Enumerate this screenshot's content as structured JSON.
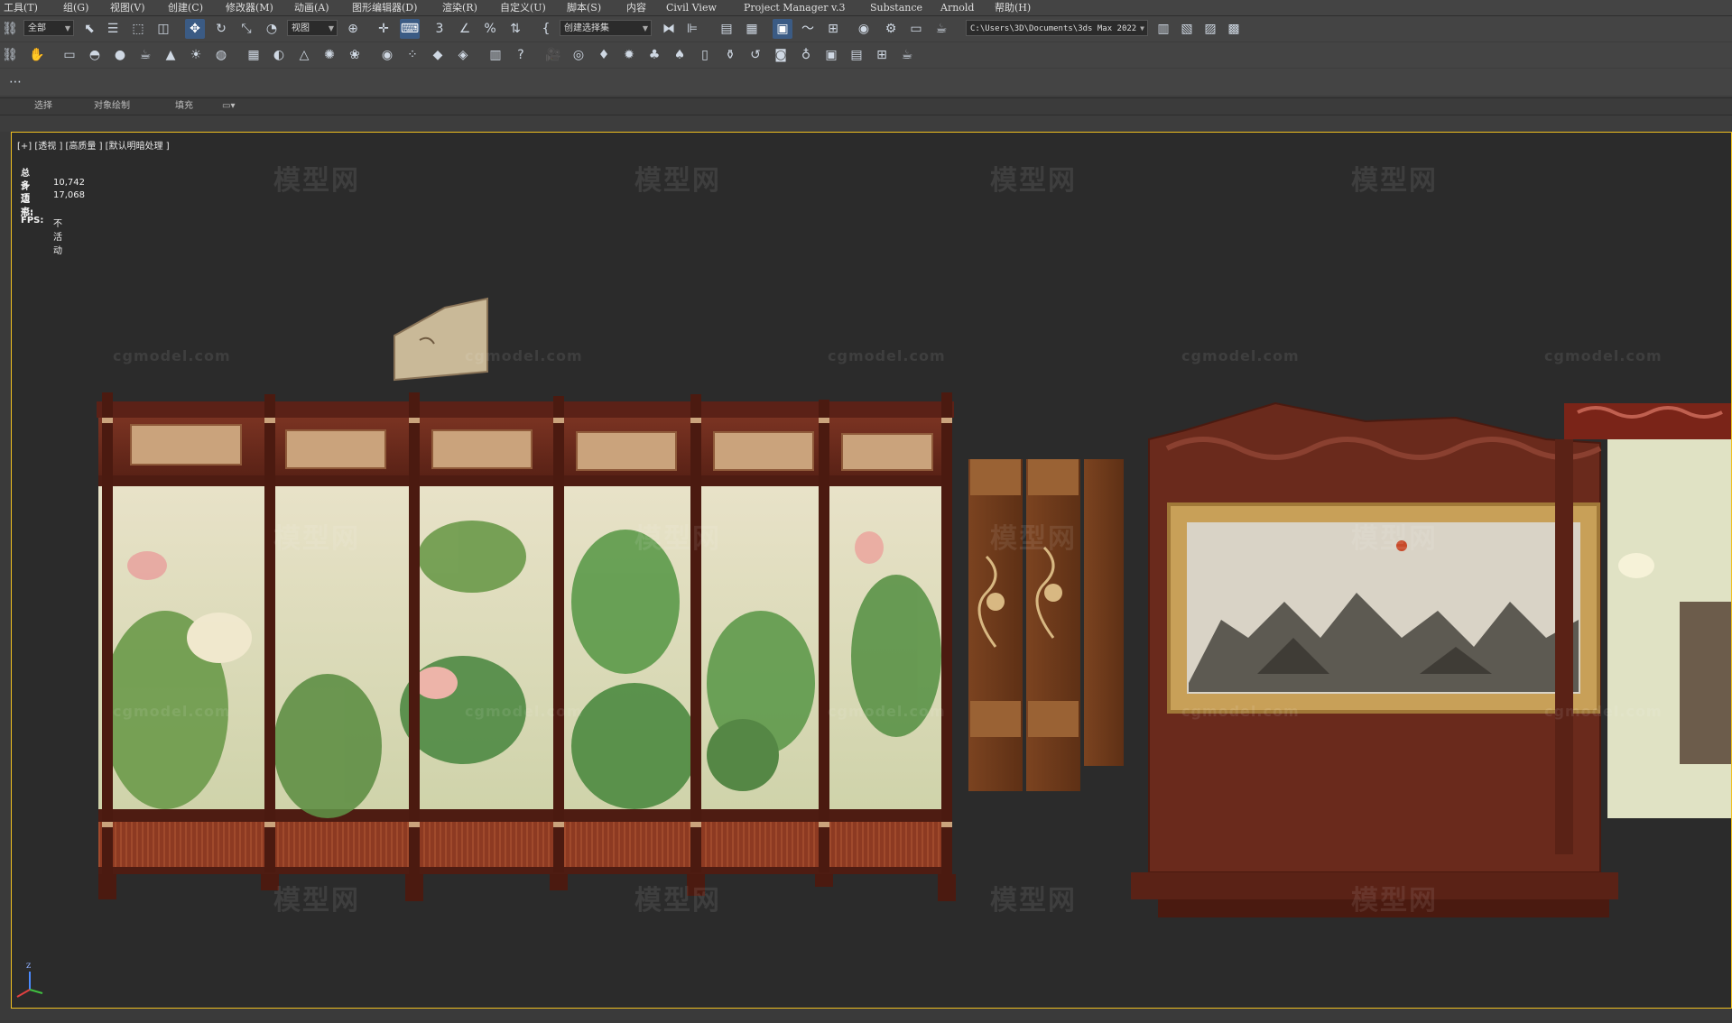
{
  "menu": [
    "工具(T)",
    "组(G)",
    "视图(V)",
    "创建(C)",
    "修改器(M)",
    "动画(A)",
    "图形编辑器(D)",
    "渲染(R)",
    "自定义(U)",
    "脚本(S)",
    "内容",
    "Civil View",
    "Project Manager v.3",
    "Substance",
    "Arnold",
    "帮助(H)"
  ],
  "toolbar": {
    "selection_filter": "全部",
    "ref_coord": "视图",
    "named_selection": "创建选择集",
    "project_path": "C:\\Users\\3D\\Documents\\3ds Max 2022"
  },
  "ribbon_tabs": [
    "选择",
    "对象绘制",
    "填充"
  ],
  "viewport": {
    "label": "[+] [透视 ] [高质量 ] [默认明暗处理 ]",
    "stats": {
      "total_label": "总计",
      "polys_label": "多边形:",
      "polys_value": "10,742",
      "verts_label": "顶点:",
      "verts_value": "17,068",
      "fps_label": "FPS:",
      "fps_value": "不活动"
    },
    "axis_label": "z"
  },
  "watermarks": {
    "cn": "模型网",
    "en": "cgmodel.com"
  },
  "colors": {
    "accent": "#f0c020",
    "frame_wood": "#6a2a1c",
    "panel_cream": "#e2dcc0"
  }
}
